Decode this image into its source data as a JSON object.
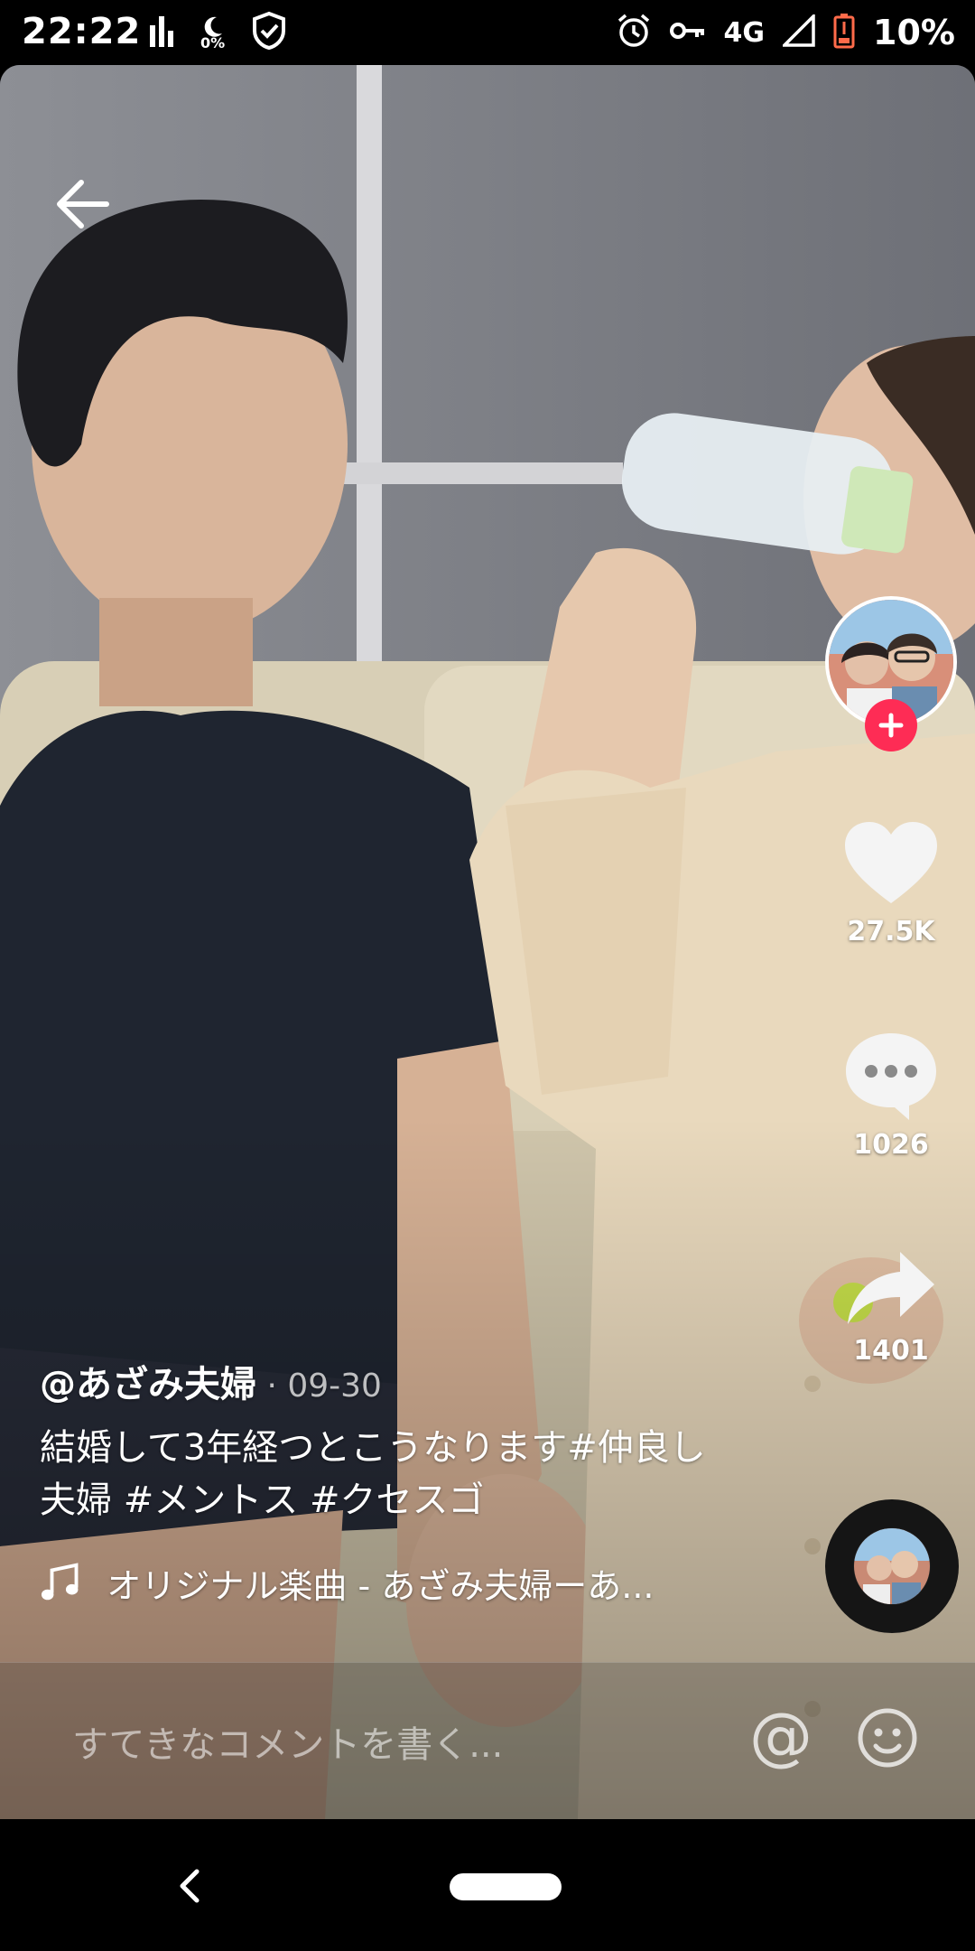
{
  "status_bar": {
    "time": "22:22",
    "night_light_percent": "0%",
    "network": "4G",
    "battery": "10%",
    "icons": [
      "bar-chart-icon",
      "night-mode-icon",
      "shield-check-icon",
      "alarm-icon",
      "key-icon",
      "signal-icon",
      "battery-low-icon"
    ]
  },
  "video": {
    "author": "@あざみ夫婦",
    "date": " · 09-30",
    "caption": "結婚して3年経つとこうなります#仲良し夫婦 #メントス #クセスゴ",
    "music": "オリジナル楽曲 - あざみ夫婦ーあ..."
  },
  "actions": {
    "likes": "27.5K",
    "comments": "1026",
    "shares": "1401"
  },
  "comment_bar": {
    "placeholder": "すてきなコメントを書く..."
  },
  "colors": {
    "follow_accent": "#fe2c55",
    "battery_low": "#ff6b4a"
  }
}
